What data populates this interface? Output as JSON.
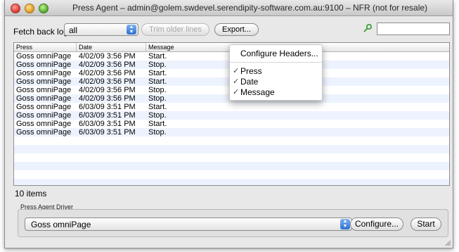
{
  "window": {
    "title": "Press Agent – admin@golem.swdevel.serendipity-software.com.au:9100 – NFR (not for resale)"
  },
  "toolbar": {
    "fetch_label": "Fetch back log:",
    "fetch_value": "all",
    "trim_label": "Trim older lines",
    "export_label": "Export...",
    "search_placeholder": ""
  },
  "table": {
    "columns": [
      "Press",
      "Date",
      "Message"
    ],
    "rows": [
      {
        "press": "Goss omniPage",
        "date": "4/02/09 3:56 PM",
        "message": "Start."
      },
      {
        "press": "Goss omniPage",
        "date": "4/02/09 3:56 PM",
        "message": "Stop."
      },
      {
        "press": "Goss omniPage",
        "date": "4/02/09 3:56 PM",
        "message": "Start."
      },
      {
        "press": "Goss omniPage",
        "date": "4/02/09 3:56 PM",
        "message": "Start."
      },
      {
        "press": "Goss omniPage",
        "date": "4/02/09 3:56 PM",
        "message": "Stop."
      },
      {
        "press": "Goss omniPage",
        "date": "4/02/09 3:56 PM",
        "message": "Stop."
      },
      {
        "press": "Goss omniPage",
        "date": "6/03/09 3:51 PM",
        "message": "Start."
      },
      {
        "press": "Goss omniPage",
        "date": "6/03/09 3:51 PM",
        "message": "Stop."
      },
      {
        "press": "Goss omniPage",
        "date": "6/03/09 3:51 PM",
        "message": "Start."
      },
      {
        "press": "Goss omniPage",
        "date": "6/03/09 3:51 PM",
        "message": "Stop."
      }
    ]
  },
  "context_menu": {
    "configure_headers": "Configure Headers...",
    "items": [
      {
        "label": "Press",
        "checked": true
      },
      {
        "label": "Date",
        "checked": true
      },
      {
        "label": "Message",
        "checked": true
      }
    ],
    "check_glyph": "✓"
  },
  "status": {
    "items_count": "10 items"
  },
  "driver": {
    "group_label": "Press Agent Driver",
    "selected": "Goss omniPage",
    "configure_label": "Configure...",
    "start_label": "Start"
  },
  "colors": {
    "alt_row": "#edf3fe",
    "accent": "#2d6fd3",
    "search_icon": "#2e9a2e"
  }
}
